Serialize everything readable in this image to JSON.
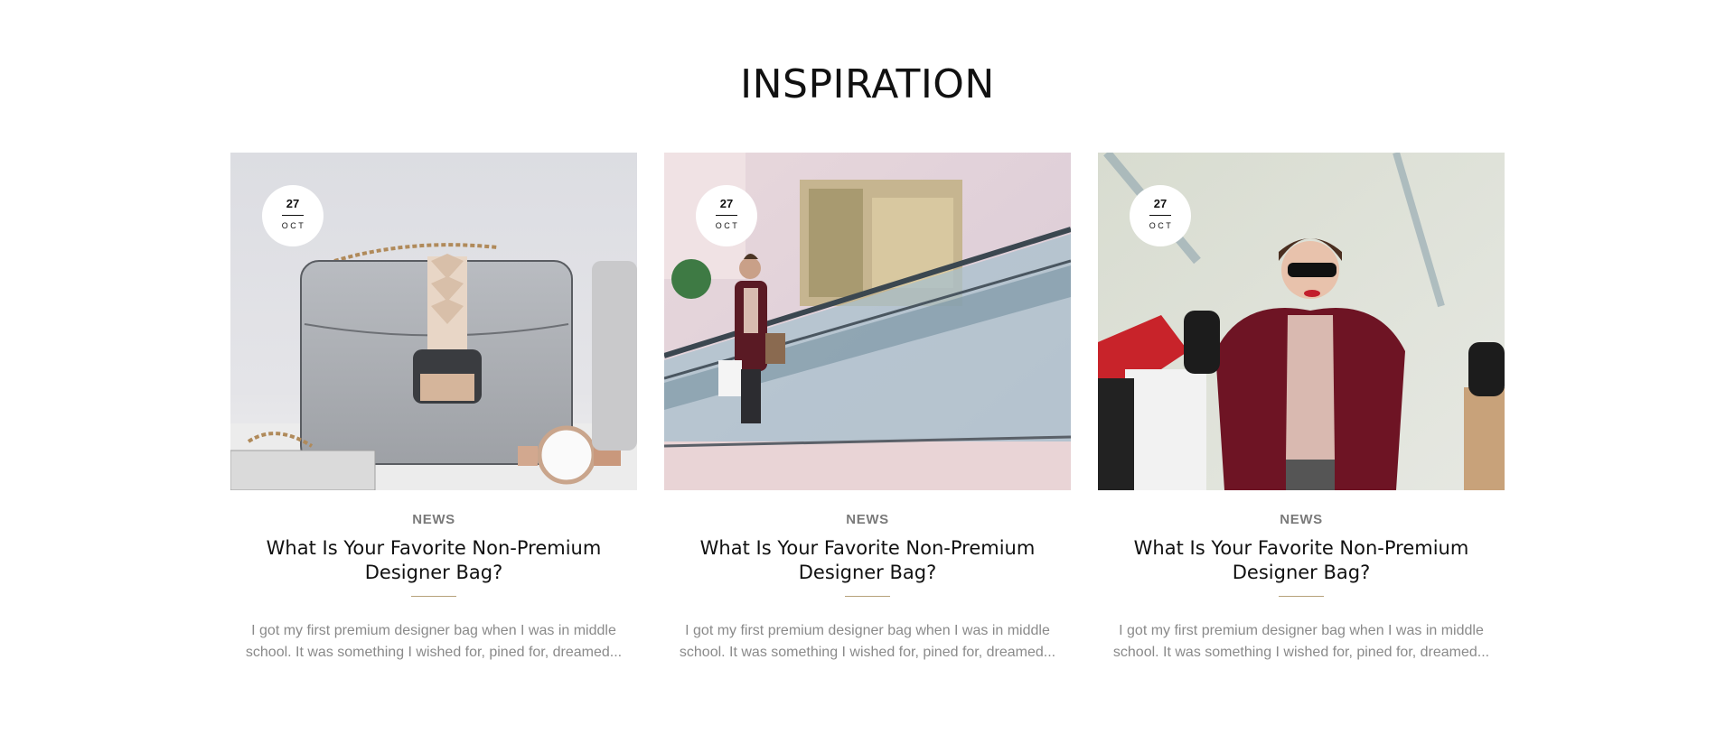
{
  "section": {
    "title": "INSPIRATION"
  },
  "posts": [
    {
      "date_day": "27",
      "date_month": "OCT",
      "category": "NEWS",
      "title": "What Is Your Favorite Non-Premium Designer Bag?",
      "excerpt": "I got my first premium designer bag when I was in middle school. It was something I wished for, pined for, dreamed...",
      "image": "grey-handbag-with-watch"
    },
    {
      "date_day": "27",
      "date_month": "OCT",
      "category": "NEWS",
      "title": "What Is Your Favorite Non-Premium Designer Bag?",
      "excerpt": "I got my first premium designer bag when I was in middle school. It was something I wished for, pined for, dreamed...",
      "image": "woman-on-mall-escalator"
    },
    {
      "date_day": "27",
      "date_month": "OCT",
      "category": "NEWS",
      "title": "What Is Your Favorite Non-Premium Designer Bag?",
      "excerpt": "I got my first premium designer bag when I was in middle school. It was something I wished for, pined for, dreamed...",
      "image": "woman-with-shopping-bags"
    }
  ],
  "colors": {
    "accent_rule": "#b7a27a",
    "category_text": "#7a7a7a",
    "excerpt_text": "#8a8a8a"
  }
}
